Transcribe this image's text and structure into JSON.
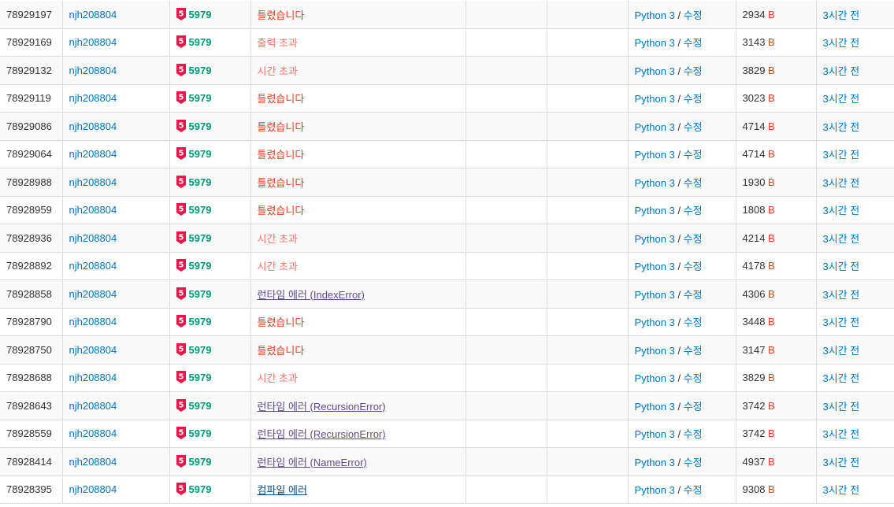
{
  "colors": {
    "link": "#0076c0",
    "problem_number": "#009874",
    "tier_badge": "#e8174b",
    "wrong": "#dd4124",
    "time_limit": "#fa7268",
    "runtime_error": "#5f4b8b",
    "compile_error": "#0f4c81",
    "row_alt": "#f9f9f9",
    "border": "#dddddd"
  },
  "tier_icon": "ruby-5-tier-icon",
  "rows": [
    {
      "id": "78929197",
      "user": "njh208804",
      "tier": "5",
      "problem": "5979",
      "result": "틀렸습니다",
      "result_type": "wrong",
      "memory": "",
      "time": "",
      "language": "Python 3",
      "edit": "수정",
      "code_length": "2934",
      "unit": "B",
      "submitted": "3시간 전"
    },
    {
      "id": "78929169",
      "user": "njh208804",
      "tier": "5",
      "problem": "5979",
      "result": "출력 초과",
      "result_type": "output",
      "memory": "",
      "time": "",
      "language": "Python 3",
      "edit": "수정",
      "code_length": "3143",
      "unit": "B",
      "submitted": "3시간 전"
    },
    {
      "id": "78929132",
      "user": "njh208804",
      "tier": "5",
      "problem": "5979",
      "result": "시간 초과",
      "result_type": "time",
      "memory": "",
      "time": "",
      "language": "Python 3",
      "edit": "수정",
      "code_length": "3829",
      "unit": "B",
      "submitted": "3시간 전"
    },
    {
      "id": "78929119",
      "user": "njh208804",
      "tier": "5",
      "problem": "5979",
      "result": "틀렸습니다",
      "result_type": "wrong",
      "memory": "",
      "time": "",
      "language": "Python 3",
      "edit": "수정",
      "code_length": "3023",
      "unit": "B",
      "submitted": "3시간 전"
    },
    {
      "id": "78929086",
      "user": "njh208804",
      "tier": "5",
      "problem": "5979",
      "result": "틀렸습니다",
      "result_type": "wrong",
      "memory": "",
      "time": "",
      "language": "Python 3",
      "edit": "수정",
      "code_length": "4714",
      "unit": "B",
      "submitted": "3시간 전"
    },
    {
      "id": "78929064",
      "user": "njh208804",
      "tier": "5",
      "problem": "5979",
      "result": "틀렸습니다",
      "result_type": "wrong",
      "memory": "",
      "time": "",
      "language": "Python 3",
      "edit": "수정",
      "code_length": "4714",
      "unit": "B",
      "submitted": "3시간 전"
    },
    {
      "id": "78928988",
      "user": "njh208804",
      "tier": "5",
      "problem": "5979",
      "result": "틀렸습니다",
      "result_type": "wrong",
      "memory": "",
      "time": "",
      "language": "Python 3",
      "edit": "수정",
      "code_length": "1930",
      "unit": "B",
      "submitted": "3시간 전"
    },
    {
      "id": "78928959",
      "user": "njh208804",
      "tier": "5",
      "problem": "5979",
      "result": "틀렸습니다",
      "result_type": "wrong",
      "memory": "",
      "time": "",
      "language": "Python 3",
      "edit": "수정",
      "code_length": "1808",
      "unit": "B",
      "submitted": "3시간 전"
    },
    {
      "id": "78928936",
      "user": "njh208804",
      "tier": "5",
      "problem": "5979",
      "result": "시간 초과",
      "result_type": "time",
      "memory": "",
      "time": "",
      "language": "Python 3",
      "edit": "수정",
      "code_length": "4214",
      "unit": "B",
      "submitted": "3시간 전"
    },
    {
      "id": "78928892",
      "user": "njh208804",
      "tier": "5",
      "problem": "5979",
      "result": "시간 초과",
      "result_type": "time",
      "memory": "",
      "time": "",
      "language": "Python 3",
      "edit": "수정",
      "code_length": "4178",
      "unit": "B",
      "submitted": "3시간 전"
    },
    {
      "id": "78928858",
      "user": "njh208804",
      "tier": "5",
      "problem": "5979",
      "result": "런타임 에러 (IndexError)",
      "result_type": "runtime",
      "memory": "",
      "time": "",
      "language": "Python 3",
      "edit": "수정",
      "code_length": "4306",
      "unit": "B",
      "submitted": "3시간 전"
    },
    {
      "id": "78928790",
      "user": "njh208804",
      "tier": "5",
      "problem": "5979",
      "result": "틀렸습니다",
      "result_type": "wrong",
      "memory": "",
      "time": "",
      "language": "Python 3",
      "edit": "수정",
      "code_length": "3448",
      "unit": "B",
      "submitted": "3시간 전"
    },
    {
      "id": "78928750",
      "user": "njh208804",
      "tier": "5",
      "problem": "5979",
      "result": "틀렸습니다",
      "result_type": "wrong",
      "memory": "",
      "time": "",
      "language": "Python 3",
      "edit": "수정",
      "code_length": "3147",
      "unit": "B",
      "submitted": "3시간 전"
    },
    {
      "id": "78928688",
      "user": "njh208804",
      "tier": "5",
      "problem": "5979",
      "result": "시간 초과",
      "result_type": "time",
      "memory": "",
      "time": "",
      "language": "Python 3",
      "edit": "수정",
      "code_length": "3829",
      "unit": "B",
      "submitted": "3시간 전"
    },
    {
      "id": "78928643",
      "user": "njh208804",
      "tier": "5",
      "problem": "5979",
      "result": "런타임 에러 (RecursionError)",
      "result_type": "runtime",
      "memory": "",
      "time": "",
      "language": "Python 3",
      "edit": "수정",
      "code_length": "3742",
      "unit": "B",
      "submitted": "3시간 전"
    },
    {
      "id": "78928559",
      "user": "njh208804",
      "tier": "5",
      "problem": "5979",
      "result": "런타임 에러 (RecursionError)",
      "result_type": "runtime",
      "memory": "",
      "time": "",
      "language": "Python 3",
      "edit": "수정",
      "code_length": "3742",
      "unit": "B",
      "submitted": "3시간 전"
    },
    {
      "id": "78928414",
      "user": "njh208804",
      "tier": "5",
      "problem": "5979",
      "result": "런타임 에러 (NameError)",
      "result_type": "runtime",
      "memory": "",
      "time": "",
      "language": "Python 3",
      "edit": "수정",
      "code_length": "4937",
      "unit": "B",
      "submitted": "3시간 전"
    },
    {
      "id": "78928395",
      "user": "njh208804",
      "tier": "5",
      "problem": "5979",
      "result": "컴파일 에러",
      "result_type": "compile",
      "memory": "",
      "time": "",
      "language": "Python 3",
      "edit": "수정",
      "code_length": "9308",
      "unit": "B",
      "submitted": "3시간 전"
    }
  ]
}
